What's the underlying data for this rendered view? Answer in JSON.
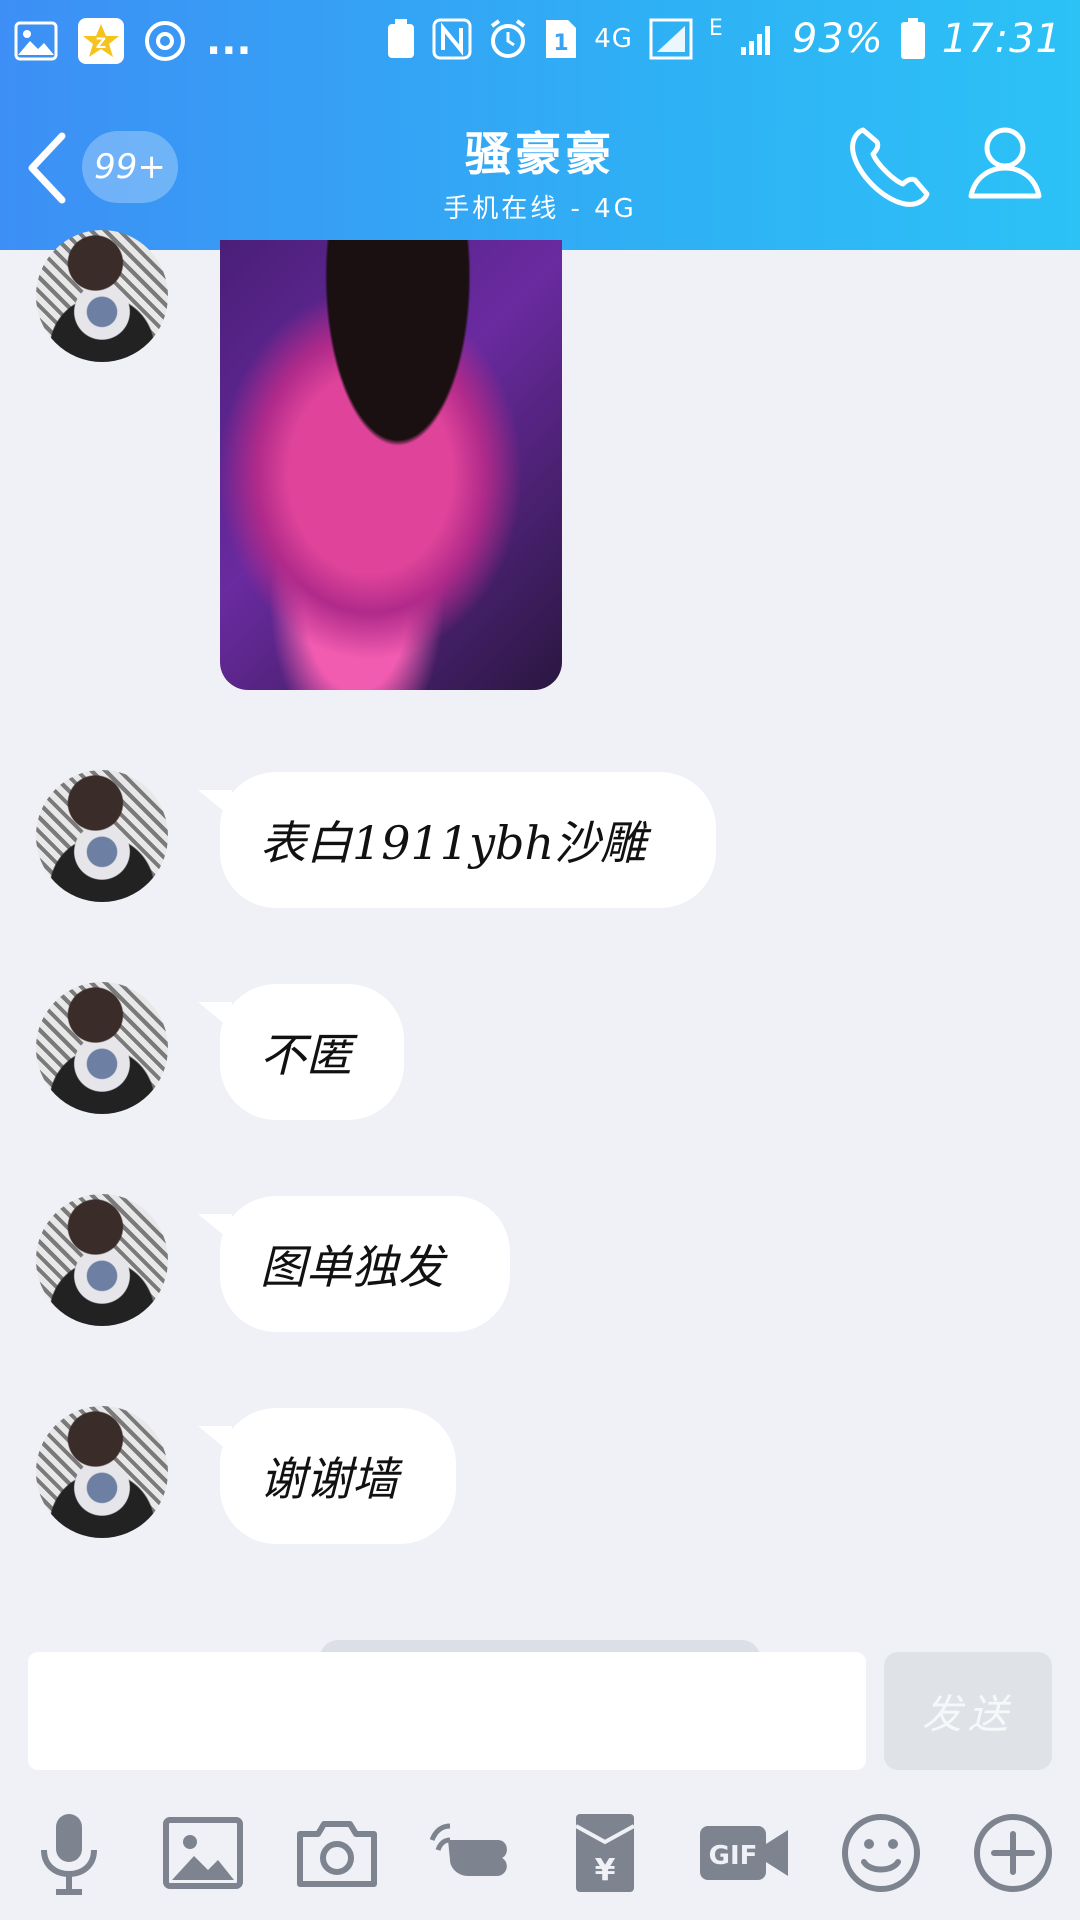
{
  "status_bar": {
    "network_label": "4G",
    "network_small": "E",
    "sim_slot": "1",
    "battery": "93%",
    "time": "17:31",
    "overflow": "..."
  },
  "header": {
    "unread_badge": "99+",
    "contact_name": "骚豪豪",
    "contact_status": "手机在线 - 4G"
  },
  "messages": [
    {
      "type": "image",
      "description_icon": "photo"
    },
    {
      "type": "text",
      "text": "表白1911ybh沙雕"
    },
    {
      "type": "text",
      "text": "不匿"
    },
    {
      "type": "text",
      "text": "图单独发"
    },
    {
      "type": "text",
      "text": "谢谢墙"
    }
  ],
  "input": {
    "value": "",
    "send_label": "发送"
  },
  "toolbar": {
    "items": [
      "microphone-icon",
      "image-icon",
      "camera-icon",
      "poke-icon",
      "red-packet-icon",
      "gif-icon",
      "emoji-icon",
      "plus-icon"
    ],
    "gif_label": "GIF",
    "red_packet_label": "¥"
  },
  "colors": {
    "header_start": "#3d8ff5",
    "header_end": "#2cc2f6",
    "background": "#eff1f6",
    "bubble": "#ffffff",
    "icon_gray": "#7d848f"
  }
}
